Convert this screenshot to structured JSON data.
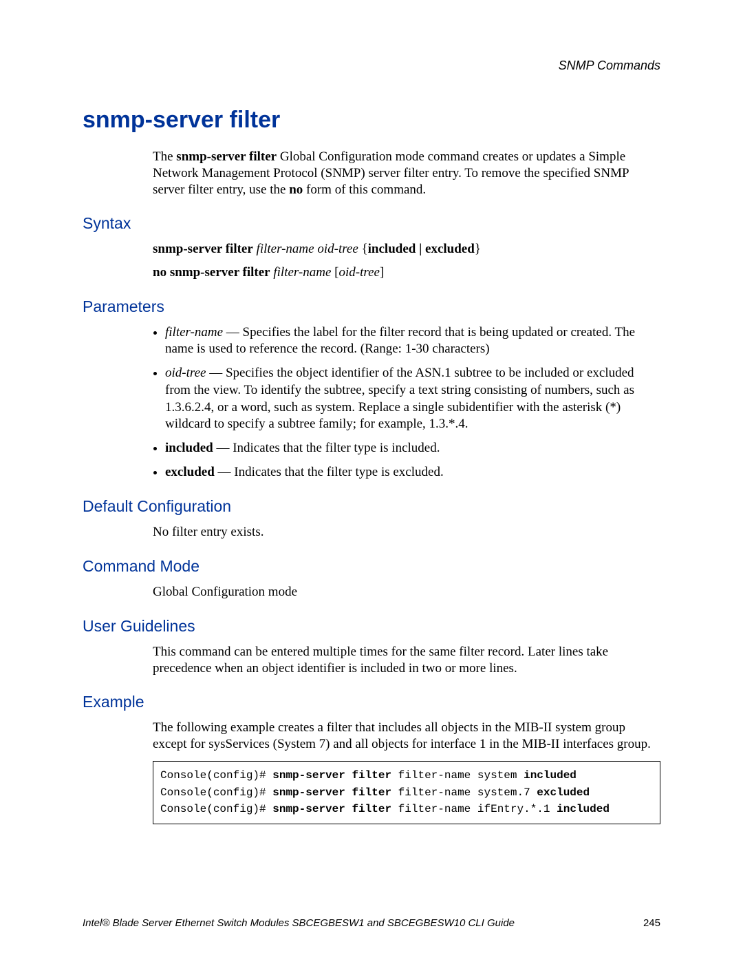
{
  "header": {
    "chapter": "SNMP Commands"
  },
  "title": "snmp-server filter",
  "intro": {
    "p1a": "The ",
    "p1b": "snmp-server filter",
    "p1c": " Global Configuration mode command creates or updates a Simple Network Management Protocol (SNMP) server filter entry. To remove the specified SNMP server filter entry, use the ",
    "p1d": "no",
    "p1e": " form of this command."
  },
  "sections": {
    "syntax": {
      "heading": "Syntax",
      "line1": {
        "cmd": "snmp-server filter",
        "args": "filter-name oid-tree",
        "brace_open": " {",
        "opt": "included | excluded",
        "brace_close": "}"
      },
      "line2": {
        "cmd": "no snmp-server filter",
        "arg1": "filter-name",
        "lb": " [",
        "arg2": "oid-tree",
        "rb": "]"
      }
    },
    "parameters": {
      "heading": "Parameters",
      "items": [
        {
          "term": "filter-name",
          "sep": " — ",
          "desc": "Specifies the label for the filter record that is being updated or created. The name is used to reference the record. (Range: 1-30 characters)",
          "term_italic": true
        },
        {
          "term": "oid-tree",
          "sep": " — ",
          "desc": "Specifies the object identifier of the ASN.1 subtree to be included or excluded from the view. To identify the subtree, specify a text string consisting of numbers, such as 1.3.6.2.4, or a word, such as system. Replace a single subidentifier with the asterisk (*) wildcard to specify a subtree family; for example, 1.3.*.4.",
          "term_italic": true
        },
        {
          "term": "included",
          "sep": " — ",
          "desc": "Indicates that the filter type is included.",
          "term_bold": true
        },
        {
          "term": "excluded",
          "sep": " — ",
          "desc": "Indicates that the filter type is excluded.",
          "term_bold": true
        }
      ]
    },
    "default_config": {
      "heading": "Default Configuration",
      "text": "No filter entry exists."
    },
    "command_mode": {
      "heading": "Command Mode",
      "text": "Global Configuration mode"
    },
    "user_guidelines": {
      "heading": "User Guidelines",
      "text": "This command can be entered multiple times for the same filter record. Later lines take precedence when an object identifier is included in two or more lines."
    },
    "example": {
      "heading": "Example",
      "text": "The following example creates a filter that includes all objects in the MIB-II system group except for sysServices (System 7) and all objects for interface 1 in the MIB-II interfaces group.",
      "code": {
        "prompt": "Console(config)# ",
        "cmd": "snmp-server filter",
        "ln1_args": " filter-name system ",
        "ln1_tail": "included",
        "ln2_args": " filter-name system.7 ",
        "ln2_tail": "excluded",
        "ln3_args": " filter-name ifEntry.*.1 ",
        "ln3_tail": "included"
      }
    }
  },
  "footer": {
    "text": "Intel® Blade Server Ethernet Switch Modules SBCEGBESW1 and SBCEGBESW10 CLI Guide",
    "page": "245"
  }
}
